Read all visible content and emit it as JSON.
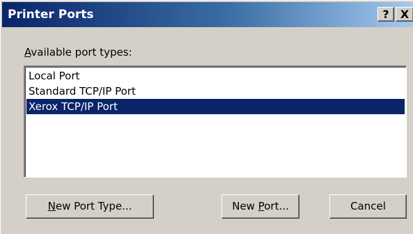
{
  "window": {
    "title": "Printer Ports",
    "help_button_label": "?",
    "close_button_label": "X"
  },
  "port_types": {
    "label_accelerator": "A",
    "label_rest": "vailable port types:",
    "items": [
      {
        "label": "Local Port",
        "selected": false
      },
      {
        "label": "Standard TCP/IP Port",
        "selected": false
      },
      {
        "label": "Xerox TCP/IP Port",
        "selected": true
      }
    ]
  },
  "buttons": {
    "new_port_type": {
      "accelerator": "N",
      "rest": "ew Port Type..."
    },
    "new_port": {
      "before": "New ",
      "accelerator": "P",
      "rest": "ort..."
    },
    "cancel": {
      "label": "Cancel"
    }
  },
  "colors": {
    "title_bar_start": "#0a246a",
    "title_bar_end": "#a6caf0",
    "selection": "#0a246a",
    "face": "#d4d0c8"
  }
}
